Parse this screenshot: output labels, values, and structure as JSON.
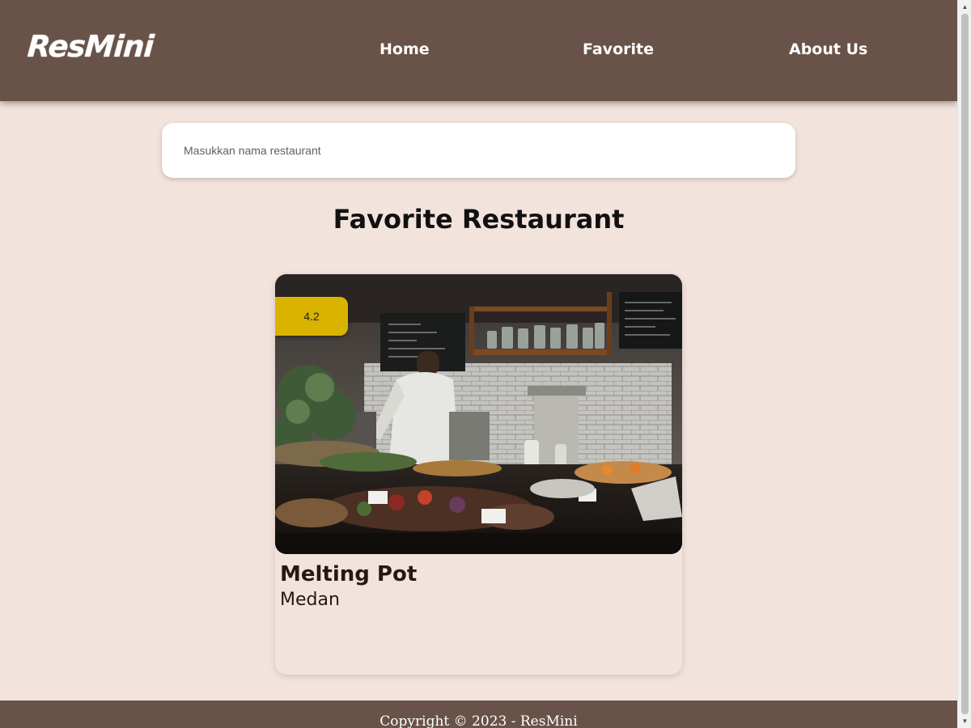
{
  "header": {
    "logo": "ResMini",
    "nav": [
      {
        "label": "Home"
      },
      {
        "label": "Favorite"
      },
      {
        "label": "About Us"
      }
    ]
  },
  "search": {
    "placeholder": "Masukkan nama restaurant",
    "value": ""
  },
  "main": {
    "title": "Favorite Restaurant",
    "restaurants": [
      {
        "name": "Melting Pot",
        "city": "Medan",
        "rating": "4.2"
      }
    ]
  },
  "footer": {
    "text": "Copyright © 2023 - ResMini"
  },
  "colors": {
    "header_bg": "#695349",
    "page_bg": "#f3e3dd",
    "rating_badge": "#d9b300"
  },
  "icons": {
    "scroll_up": "triangle-up-icon",
    "scroll_down": "triangle-down-icon"
  }
}
